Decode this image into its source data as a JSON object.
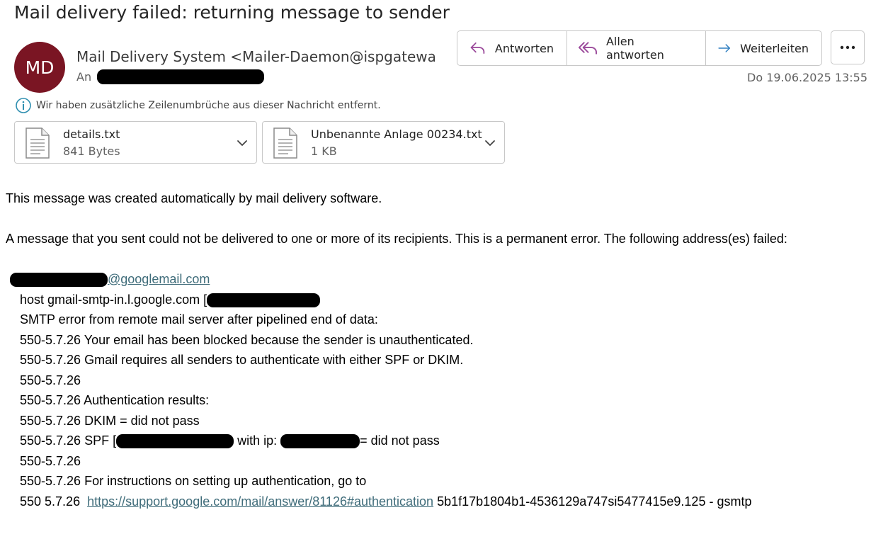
{
  "subject": "Mail delivery failed: returning message to sender",
  "sender": {
    "initials": "MD",
    "avatar_color": "#7a1523",
    "display": "Mail Delivery System <Mailer-Daemon@ispgatewa",
    "to_label": "An"
  },
  "actions": {
    "reply": "Antworten",
    "reply_all": "Allen antworten",
    "forward": "Weiterleiten",
    "more": "..."
  },
  "date": "Do 19.06.2025 13:55",
  "info": "Wir haben zusätzliche Zeilenumbrüche aus dieser Nachricht entfernt.",
  "attachments": [
    {
      "name": "details.txt",
      "size": "841 Bytes"
    },
    {
      "name": "Unbenannte Anlage 00234.txt",
      "size": "1 KB"
    }
  ],
  "body": {
    "intro": "This message was created automatically by mail delivery software.",
    "failed": "A message that you sent could not be delivered to one or more of its recipients. This is a permanent error. The following address(es) failed:",
    "recipient_domain": "@googlemail.com",
    "host_prefix": "host gmail-smtp-in.l.google.com [",
    "smtp_error": "SMTP error from remote mail server after pipelined end of data:",
    "l1": "550-5.7.26 Your email has been blocked because the sender is unauthenticated.",
    "l2": "550-5.7.26 Gmail requires all senders to authenticate with either SPF or DKIM.",
    "l3": "550-5.7.26",
    "l4": "550-5.7.26  Authentication results:",
    "l5": "550-5.7.26  DKIM = did not pass",
    "l6_prefix": "550-5.7.26  SPF [",
    "l6_mid": " with ip: ",
    "l6_suffix": "= did not pass",
    "l7": "550-5.7.26",
    "l8": "550-5.7.26  For instructions on setting up authentication, go to",
    "l9_prefix": "550 5.7.26  ",
    "l9_link": "https://support.google.com/mail/answer/81126#authentication",
    "l9_suffix": " 5b1f17b1804b1-4536129a747si5477415e9.125 - gsmtp"
  },
  "colors": {
    "link": "#3f6c7a",
    "reply_icon": "#9b4a9b",
    "forward_icon": "#2f7fc1",
    "info_icon": "#2f8fb0"
  }
}
